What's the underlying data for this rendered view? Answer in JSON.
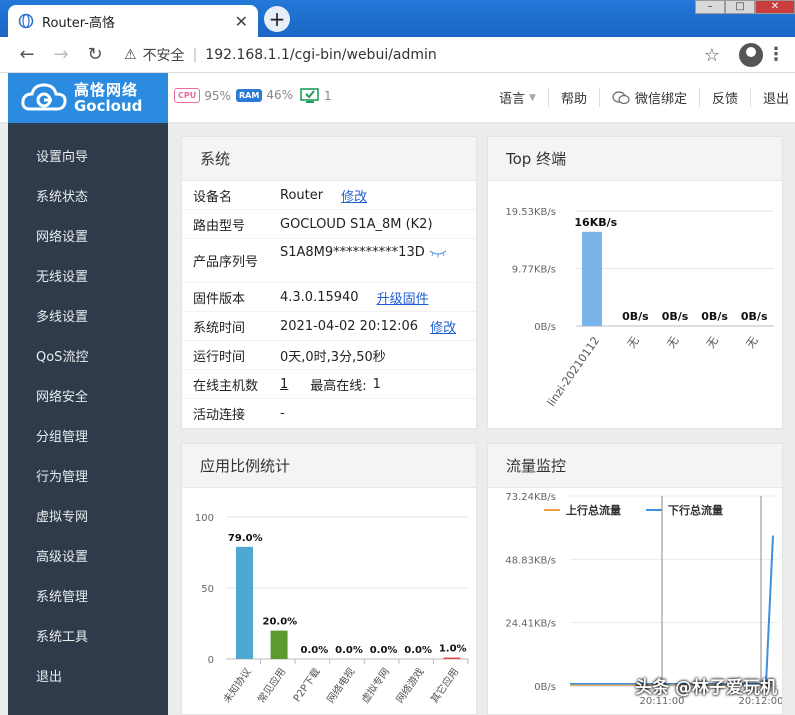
{
  "browser": {
    "tab_title": "Router-高恪",
    "insecure_label": "不安全",
    "url": "192.168.1.1/cgi-bin/webui/admin"
  },
  "header": {
    "logo_cn": "高恪网络",
    "logo_en": "Gocloud",
    "cpu_label": "CPU",
    "cpu_value": "95%",
    "ram_label": "RAM",
    "ram_value": "46%",
    "online_value": "1",
    "nav": [
      "语言",
      "帮助",
      "微信绑定",
      "反馈",
      "退出"
    ]
  },
  "sidebar": {
    "items": [
      "设置向导",
      "系统状态",
      "网络设置",
      "无线设置",
      "多线设置",
      "QoS流控",
      "网络安全",
      "分组管理",
      "行为管理",
      "虚拟专网",
      "高级设置",
      "系统管理",
      "系统工具",
      "退出"
    ]
  },
  "system_panel": {
    "title": "系统",
    "rows": [
      {
        "label": "设备名",
        "value": "Router",
        "link": "修改"
      },
      {
        "label": "路由型号",
        "value": "GOCLOUD S1A_8M (K2)"
      },
      {
        "label": "产品序列号",
        "value": "S1A8M9**********13D"
      },
      {
        "label": "固件版本",
        "value": "4.3.0.15940",
        "link": "升级固件"
      },
      {
        "label": "系统时间",
        "value": "2021-04-02 20:12:06",
        "link": "修改"
      },
      {
        "label": "运行时间",
        "value": "0天,0时,3分,50秒"
      },
      {
        "label": "在线主机数",
        "value": "1",
        "extra_label": "最高在线:",
        "extra_value": "1"
      },
      {
        "label": "活动连接",
        "value": "-"
      }
    ]
  },
  "top_panel": {
    "title": "Top 终端"
  },
  "app_panel": {
    "title": "应用比例统计"
  },
  "traffic_panel": {
    "title": "流量监控"
  },
  "watermark": "头条 @林子爱玩机",
  "chart_data": [
    {
      "type": "bar",
      "categories": [
        "linzi-20210112",
        "无",
        "无",
        "无",
        "无"
      ],
      "values": [
        16,
        0,
        0,
        0,
        0
      ],
      "data_labels": [
        "16KB/s",
        "0B/s",
        "0B/s",
        "0B/s",
        "0B/s"
      ],
      "y_ticks": [
        "19.53KB/s",
        "9.77KB/s",
        "0B/s"
      ],
      "ylim": [
        0,
        19.53
      ],
      "color": "#79b5e8"
    },
    {
      "type": "bar",
      "categories": [
        "未知协议",
        "常见应用",
        "P2P下载",
        "网络电视",
        "虚拟专网",
        "网络游戏",
        "其它应用"
      ],
      "values": [
        79.0,
        20.0,
        0.0,
        0.0,
        0.0,
        0.0,
        1.0
      ],
      "data_labels": [
        "79.0%",
        "20.0%",
        "0.0%",
        "0.0%",
        "0.0%",
        "0.0%",
        "1.0%"
      ],
      "y_ticks": [
        "100",
        "50",
        "0"
      ],
      "ylim": [
        0,
        100
      ],
      "colors": [
        "#4ea9d1",
        "#5a9a2e",
        "#888888",
        "#888888",
        "#888888",
        "#888888",
        "#d44"
      ]
    },
    {
      "type": "line",
      "series": [
        {
          "name": "上行总流量",
          "color": "#f0a040"
        },
        {
          "name": "下行总流量",
          "color": "#3d8fe0"
        }
      ],
      "y_ticks": [
        "73.24KB/s",
        "48.83KB/s",
        "24.41KB/s",
        "0B/s"
      ],
      "ylim": [
        0,
        73.24
      ],
      "x_ticks": [
        "20:11:00",
        "20:12:00"
      ],
      "download_end_value": 58
    }
  ]
}
